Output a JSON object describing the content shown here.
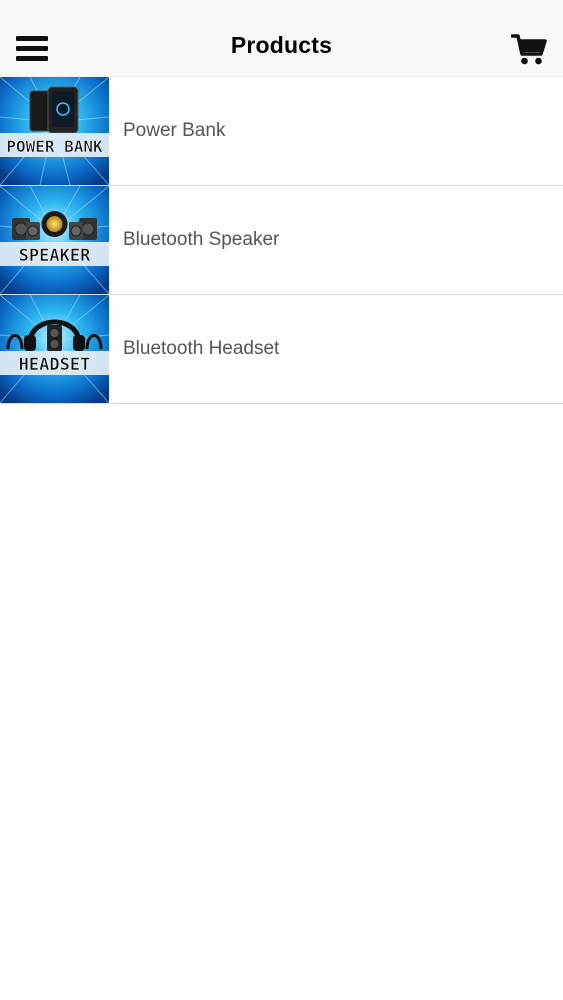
{
  "header": {
    "title": "Products",
    "menu_icon": "hamburger-menu-icon",
    "cart_icon": "shopping-cart-icon"
  },
  "products": [
    {
      "name": "Power Bank",
      "image_text": "POWER BANK",
      "image_subject": "power-bank-devices"
    },
    {
      "name": "Bluetooth Speaker",
      "image_text": "SPEAKER",
      "image_subject": "speaker-set"
    },
    {
      "name": "Bluetooth Headset",
      "image_text": "HEADSET",
      "image_subject": "headset-with-speaker"
    }
  ],
  "colors": {
    "thumb_blue": "#1aa3e8",
    "thumb_dark": "#0a4a9c",
    "label_text": "#555555",
    "header_bg": "#f8f8f8",
    "page_bg": "#fffefa"
  }
}
